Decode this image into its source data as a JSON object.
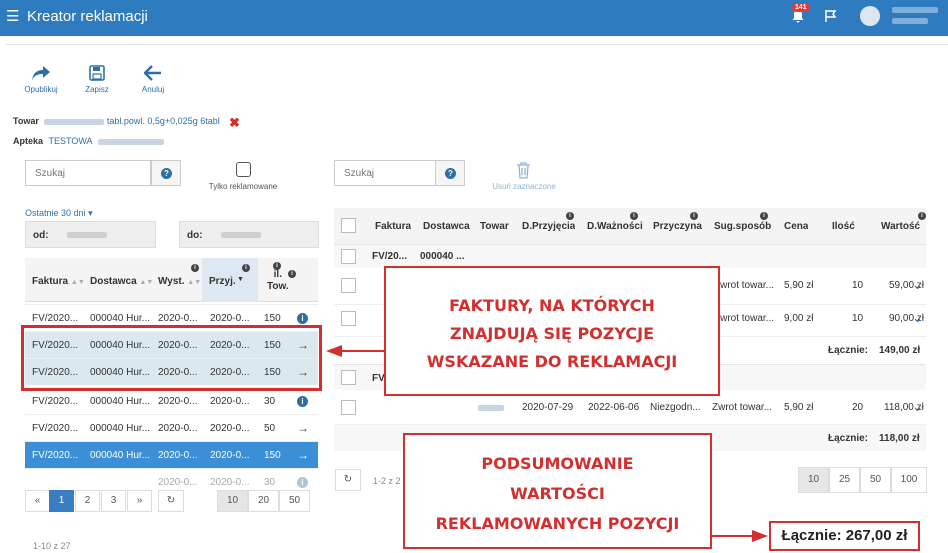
{
  "app": {
    "title": "Kreator reklamacji",
    "notif_count": "141"
  },
  "toolbar": {
    "publish": "Opublikuj",
    "save": "Zapisz",
    "cancel": "Anuluj"
  },
  "product": {
    "label": "Towar",
    "name_suffix": "tabl.powl. 0,5g+0,025g 6tabl"
  },
  "pharmacy": {
    "label": "Apteka",
    "name": "TESTOWA"
  },
  "left": {
    "search_placeholder": "Szukaj",
    "only_claimed": "Tylko reklamowane",
    "period": "Ostatnie 30 dni",
    "from_label": "od:",
    "to_label": "do:",
    "cols": [
      "Faktura",
      "Dostawca",
      "Wyst.",
      "Przyj.",
      "il.",
      "Tow."
    ],
    "rows": [
      {
        "faktura": "FV/2020...",
        "dostawca": "000040 Hur...",
        "wyst": "2020-0...",
        "przyj": "2020-0...",
        "il": "150",
        "action": "i",
        "state": "normal"
      },
      {
        "faktura": "FV/2020...",
        "dostawca": "000040 Hur...",
        "wyst": "2020-0...",
        "przyj": "2020-0...",
        "il": "150",
        "action": "→",
        "state": "claimed"
      },
      {
        "faktura": "FV/2020...",
        "dostawca": "000040 Hur...",
        "wyst": "2020-0...",
        "przyj": "2020-0...",
        "il": "150",
        "action": "→",
        "state": "claimed"
      },
      {
        "faktura": "FV/2020...",
        "dostawca": "000040 Hur...",
        "wyst": "2020-0...",
        "przyj": "2020-0...",
        "il": "30",
        "action": "i",
        "state": "normal"
      },
      {
        "faktura": "FV/2020...",
        "dostawca": "000040 Hur...",
        "wyst": "2020-0...",
        "przyj": "2020-0...",
        "il": "50",
        "action": "→",
        "state": "normal"
      },
      {
        "faktura": "FV/2020...",
        "dostawca": "000040 Hur...",
        "wyst": "2020-0...",
        "przyj": "2020-0...",
        "il": "150",
        "action": "→",
        "state": "selected"
      },
      {
        "faktura": "",
        "dostawca": "",
        "wyst": "2020-0...",
        "przyj": "2020-0...",
        "il": "30",
        "action": "i",
        "state": "faded"
      }
    ],
    "pagination": [
      "«",
      "1",
      "2",
      "3",
      "»"
    ],
    "page_sizes": [
      "10",
      "20",
      "50"
    ],
    "range": "1-10 z 27"
  },
  "right": {
    "search_placeholder": "Szukaj",
    "delete_selected": "Usuń zaznaczone",
    "cols": [
      "Faktura",
      "Dostawca",
      "Towar",
      "D.Przyjęcia",
      "D.Ważności",
      "Przyczyna",
      "Sug.sposób",
      "Cena",
      "Ilość",
      "Wartość"
    ],
    "group1": {
      "faktura": "FV/20...",
      "dostawca": "000040 ...",
      "items": [
        {
          "sposob": "Zwrot towar...",
          "cena": "5,90 zł",
          "ilosc": "10",
          "wartosc": "59,00 zł"
        },
        {
          "sposob": "Zwrot towar...",
          "cena": "9,00 zł",
          "ilosc": "10",
          "wartosc": "90,00 zł"
        }
      ],
      "sum_label": "Łącznie:",
      "sum": "149,00 zł"
    },
    "group2": {
      "faktura": "FV",
      "items": [
        {
          "przyjecia": "2020-07-29",
          "waznosci": "2022-06-06",
          "przyczyna": "Niezgodn...",
          "sposob": "Zwrot towar...",
          "cena": "5,90 zł",
          "ilosc": "20",
          "wartosc": "118,00 zł"
        }
      ],
      "sum_label": "Łącznie:",
      "sum": "118,00 zł"
    },
    "range": "1-2 z 2",
    "page_sizes": [
      "10",
      "25",
      "50",
      "100"
    ],
    "grand_total": "Łącznie: 267,00 zł"
  },
  "callouts": {
    "invoices": [
      "FAKTURY, NA KTÓRYCH",
      "ZNAJDUJĄ SIĘ POZYCJE",
      "WSKAZANE DO REKLAMACJI"
    ],
    "summary": [
      "PODSUMOWANIE",
      "WARTOŚCI",
      "REKLAMOWANYCH POZYCJI"
    ]
  },
  "colors": {
    "primary": "#2f7bbf",
    "selected_row": "#3a8fd6",
    "claimed_row": "#dbe9ee",
    "annotation": "#d32f2f"
  }
}
